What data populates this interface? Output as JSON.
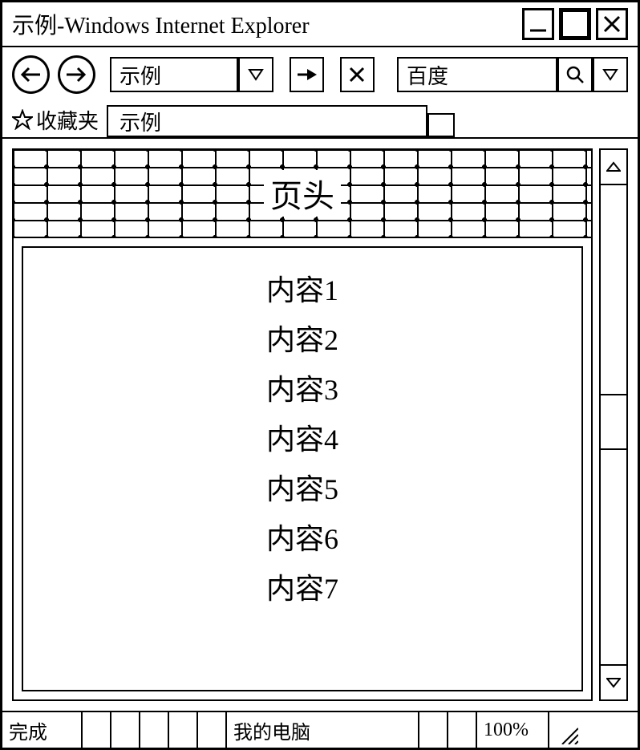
{
  "window": {
    "title": "示例-Windows Internet Explorer"
  },
  "toolbar": {
    "address_value": "示例",
    "search_value": "百度"
  },
  "favorites": {
    "label": "收藏夹"
  },
  "tabs": {
    "active_label": "示例"
  },
  "page": {
    "header_label": "页头",
    "content_items": [
      "内容1",
      "内容2",
      "内容3",
      "内容4",
      "内容5",
      "内容6",
      "内容7"
    ]
  },
  "statusbar": {
    "status_text": "完成",
    "location_text": "我的电脑",
    "zoom_text": "100%"
  }
}
